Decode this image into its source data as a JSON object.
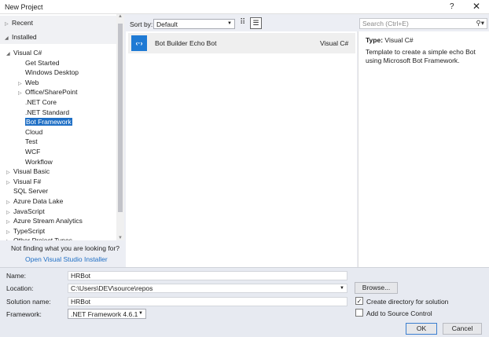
{
  "window": {
    "title": "New Project",
    "help": "?",
    "close": "✕"
  },
  "tree": {
    "recent": "Recent",
    "installed": "Installed",
    "items": [
      {
        "label": "Visual C#",
        "level": 1,
        "expander": "open"
      },
      {
        "label": "Get Started",
        "level": 2
      },
      {
        "label": "Windows Desktop",
        "level": 2
      },
      {
        "label": "Web",
        "level": 2,
        "expander": "closed"
      },
      {
        "label": "Office/SharePoint",
        "level": 2,
        "expander": "closed"
      },
      {
        "label": ".NET Core",
        "level": 2
      },
      {
        "label": ".NET Standard",
        "level": 2
      },
      {
        "label": "Bot Framework",
        "level": 2,
        "selected": true
      },
      {
        "label": "Cloud",
        "level": 2
      },
      {
        "label": "Test",
        "level": 2
      },
      {
        "label": "WCF",
        "level": 2
      },
      {
        "label": "Workflow",
        "level": 2
      },
      {
        "label": "Visual Basic",
        "level": 1,
        "expander": "closed"
      },
      {
        "label": "Visual F#",
        "level": 1,
        "expander": "closed"
      },
      {
        "label": "SQL Server",
        "level": 1
      },
      {
        "label": "Azure Data Lake",
        "level": 1,
        "expander": "closed"
      },
      {
        "label": "JavaScript",
        "level": 1,
        "expander": "closed"
      },
      {
        "label": "Azure Stream Analytics",
        "level": 1,
        "expander": "closed"
      },
      {
        "label": "TypeScript",
        "level": 1,
        "expander": "closed"
      },
      {
        "label": "Other Project Types",
        "level": 1,
        "expander": "closed"
      }
    ],
    "not_finding": "Not finding what you are looking for?",
    "installer_link": "Open Visual Studio Installer"
  },
  "toolbar": {
    "sort_label": "Sort by:",
    "sort_value": "Default",
    "search_placeholder": "Search (Ctrl+E)"
  },
  "templates": [
    {
      "name": "Bot Builder Echo Bot",
      "language": "Visual C#"
    }
  ],
  "details": {
    "type_label": "Type:",
    "type_value": "Visual C#",
    "description": "Template to create a simple echo Bot using Microsoft Bot Framework."
  },
  "form": {
    "name_label": "Name:",
    "name_value": "HRBot",
    "location_label": "Location:",
    "location_value": "C:\\Users\\DEV\\source\\repos",
    "solution_label": "Solution name:",
    "solution_value": "HRBot",
    "framework_label": "Framework:",
    "framework_value": ".NET Framework 4.6.1",
    "browse": "Browse...",
    "create_dir": "Create directory for solution",
    "create_dir_checked": true,
    "source_control": "Add to Source Control",
    "source_control_checked": false,
    "ok": "OK",
    "cancel": "Cancel"
  },
  "colors": {
    "accent": "#1f6fc5"
  }
}
